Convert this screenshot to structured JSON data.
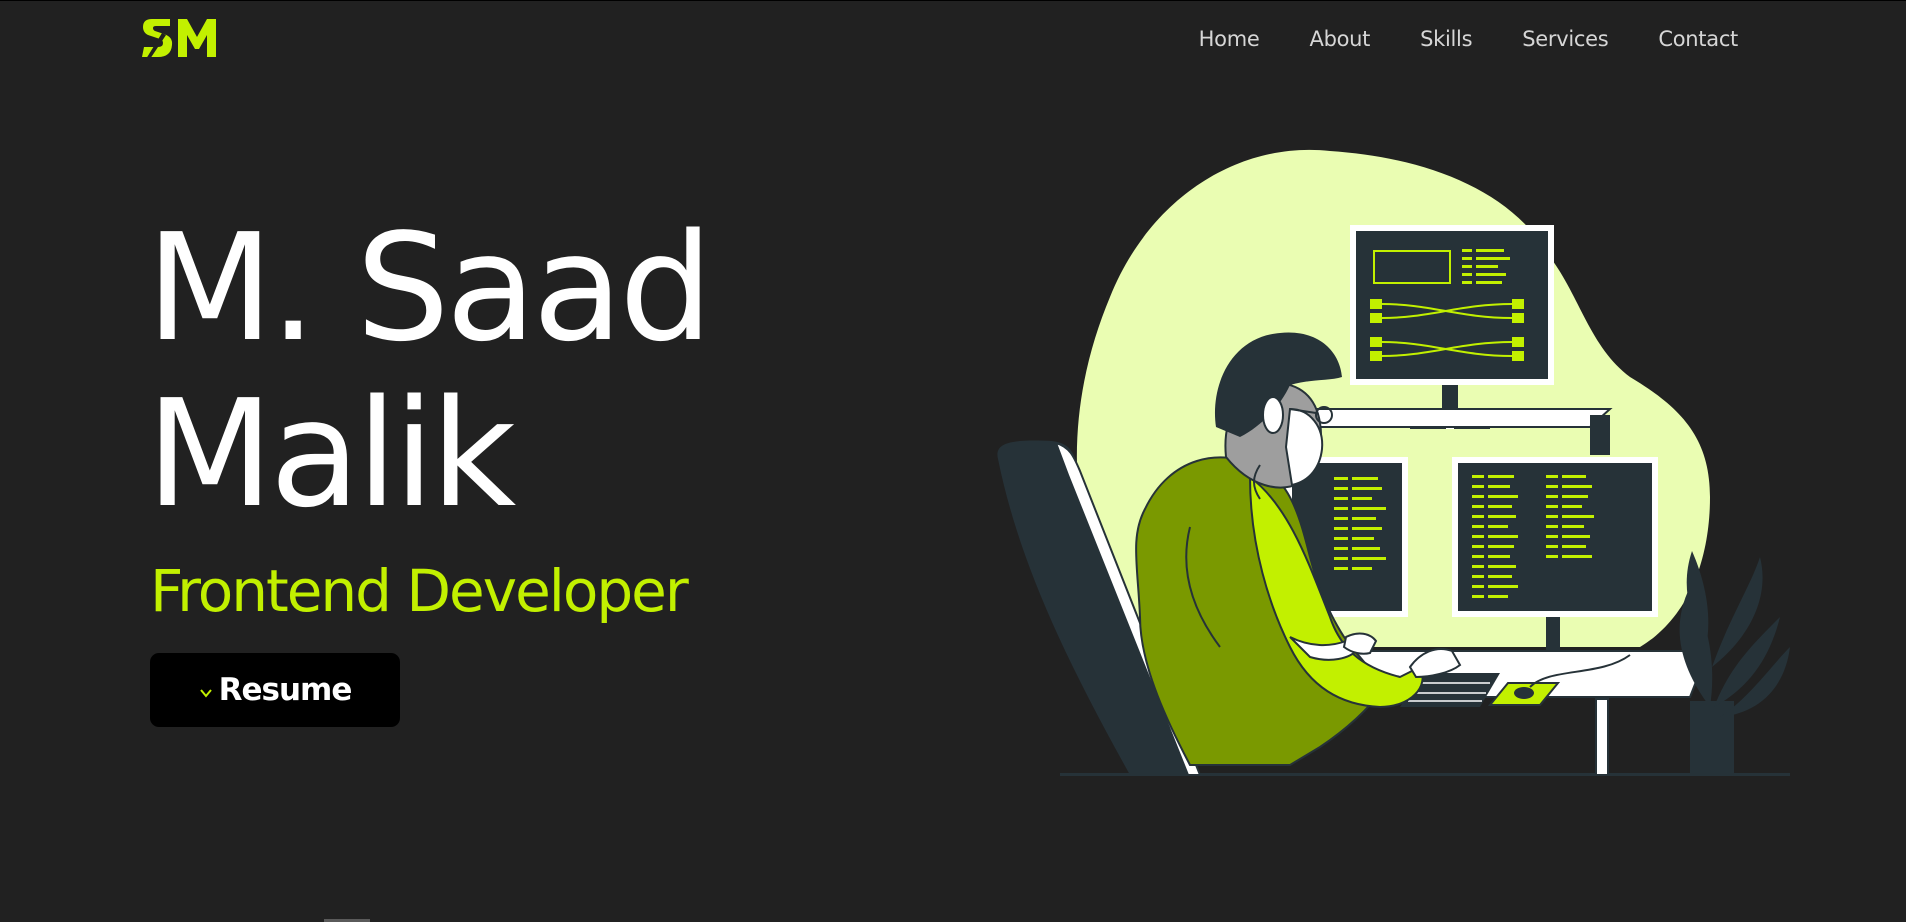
{
  "logo": {
    "icon": "sm-monogram-logo",
    "color": "#c2f000"
  },
  "nav": {
    "items": [
      {
        "label": "Home"
      },
      {
        "label": "About"
      },
      {
        "label": "Skills"
      },
      {
        "label": "Services"
      },
      {
        "label": "Contact"
      }
    ]
  },
  "hero": {
    "name_line1": "M. Saad",
    "name_line2": "Malik",
    "role": "Frontend Developer",
    "resume_label": "Resume",
    "resume_icon": "chevron-down-icon"
  },
  "illustration": {
    "description_icon": "developer-at-desk-illustration"
  },
  "colors": {
    "background": "#212121",
    "accent": "#c2f000",
    "text": "#ffffff",
    "nav_text": "#d6d6d6",
    "blob": "#eafdb2",
    "dark_navy": "#263238"
  }
}
